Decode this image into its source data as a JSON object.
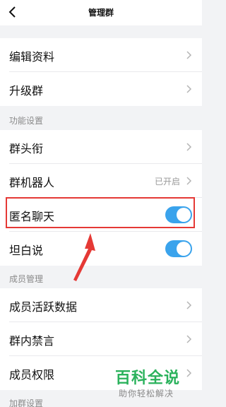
{
  "header": {
    "title": "管理群",
    "back_icon": "chevron-left-icon"
  },
  "group1": [
    {
      "label": "编辑资料"
    },
    {
      "label": "升级群"
    }
  ],
  "sections": {
    "features": "功能设置",
    "members": "成员管理",
    "join": "加群设置"
  },
  "features": [
    {
      "label": "群头衔"
    },
    {
      "label": "群机器人",
      "value": "已开启"
    },
    {
      "label": "匿名聊天",
      "toggle": true
    },
    {
      "label": "坦白说",
      "toggle": true
    }
  ],
  "members": [
    {
      "label": "成员活跃数据"
    },
    {
      "label": "群内禁言"
    },
    {
      "label": "成员权限"
    }
  ],
  "watermark": {
    "brand": "百科全说",
    "slogan": "助你轻松解决"
  },
  "colors": {
    "toggle_on": "#3aa3ec",
    "highlight": "#e53935",
    "watermark": "#2bb25c"
  }
}
